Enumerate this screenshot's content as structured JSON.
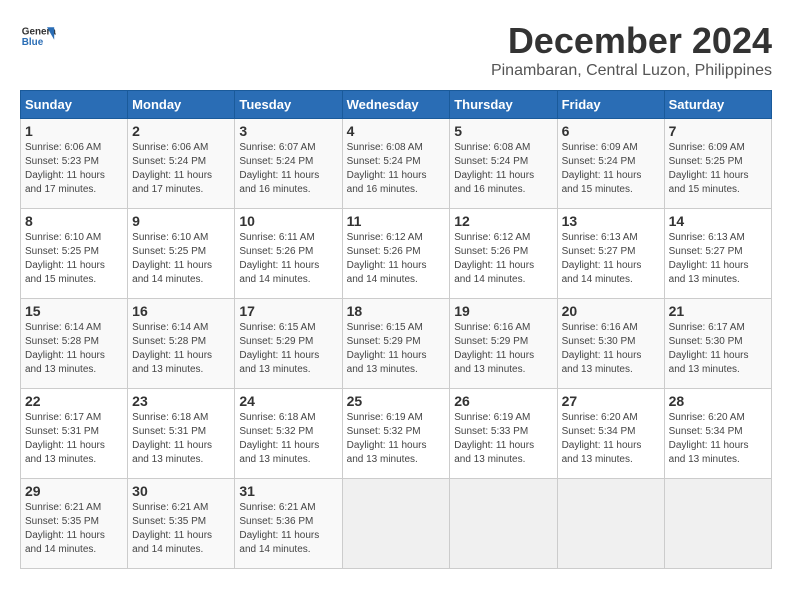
{
  "header": {
    "logo_line1": "General",
    "logo_line2": "Blue",
    "title": "December 2024",
    "subtitle": "Pinambaran, Central Luzon, Philippines"
  },
  "calendar": {
    "columns": [
      "Sunday",
      "Monday",
      "Tuesday",
      "Wednesday",
      "Thursday",
      "Friday",
      "Saturday"
    ],
    "weeks": [
      [
        null,
        {
          "day": 2,
          "sunrise": "6:06 AM",
          "sunset": "5:24 PM",
          "daylight": "11 hours and 17 minutes."
        },
        {
          "day": 3,
          "sunrise": "6:07 AM",
          "sunset": "5:24 PM",
          "daylight": "11 hours and 16 minutes."
        },
        {
          "day": 4,
          "sunrise": "6:08 AM",
          "sunset": "5:24 PM",
          "daylight": "11 hours and 16 minutes."
        },
        {
          "day": 5,
          "sunrise": "6:08 AM",
          "sunset": "5:24 PM",
          "daylight": "11 hours and 16 minutes."
        },
        {
          "day": 6,
          "sunrise": "6:09 AM",
          "sunset": "5:24 PM",
          "daylight": "11 hours and 15 minutes."
        },
        {
          "day": 7,
          "sunrise": "6:09 AM",
          "sunset": "5:25 PM",
          "daylight": "11 hours and 15 minutes."
        }
      ],
      [
        {
          "day": 1,
          "sunrise": "6:06 AM",
          "sunset": "5:23 PM",
          "daylight": "11 hours and 17 minutes."
        },
        {
          "day": 9,
          "sunrise": "6:10 AM",
          "sunset": "5:25 PM",
          "daylight": "11 hours and 14 minutes."
        },
        {
          "day": 10,
          "sunrise": "6:11 AM",
          "sunset": "5:26 PM",
          "daylight": "11 hours and 14 minutes."
        },
        {
          "day": 11,
          "sunrise": "6:12 AM",
          "sunset": "5:26 PM",
          "daylight": "11 hours and 14 minutes."
        },
        {
          "day": 12,
          "sunrise": "6:12 AM",
          "sunset": "5:26 PM",
          "daylight": "11 hours and 14 minutes."
        },
        {
          "day": 13,
          "sunrise": "6:13 AM",
          "sunset": "5:27 PM",
          "daylight": "11 hours and 14 minutes."
        },
        {
          "day": 14,
          "sunrise": "6:13 AM",
          "sunset": "5:27 PM",
          "daylight": "11 hours and 13 minutes."
        }
      ],
      [
        {
          "day": 8,
          "sunrise": "6:10 AM",
          "sunset": "5:25 PM",
          "daylight": "11 hours and 15 minutes."
        },
        {
          "day": 16,
          "sunrise": "6:14 AM",
          "sunset": "5:28 PM",
          "daylight": "11 hours and 13 minutes."
        },
        {
          "day": 17,
          "sunrise": "6:15 AM",
          "sunset": "5:29 PM",
          "daylight": "11 hours and 13 minutes."
        },
        {
          "day": 18,
          "sunrise": "6:15 AM",
          "sunset": "5:29 PM",
          "daylight": "11 hours and 13 minutes."
        },
        {
          "day": 19,
          "sunrise": "6:16 AM",
          "sunset": "5:29 PM",
          "daylight": "11 hours and 13 minutes."
        },
        {
          "day": 20,
          "sunrise": "6:16 AM",
          "sunset": "5:30 PM",
          "daylight": "11 hours and 13 minutes."
        },
        {
          "day": 21,
          "sunrise": "6:17 AM",
          "sunset": "5:30 PM",
          "daylight": "11 hours and 13 minutes."
        }
      ],
      [
        {
          "day": 15,
          "sunrise": "6:14 AM",
          "sunset": "5:28 PM",
          "daylight": "11 hours and 13 minutes."
        },
        {
          "day": 23,
          "sunrise": "6:18 AM",
          "sunset": "5:31 PM",
          "daylight": "11 hours and 13 minutes."
        },
        {
          "day": 24,
          "sunrise": "6:18 AM",
          "sunset": "5:32 PM",
          "daylight": "11 hours and 13 minutes."
        },
        {
          "day": 25,
          "sunrise": "6:19 AM",
          "sunset": "5:32 PM",
          "daylight": "11 hours and 13 minutes."
        },
        {
          "day": 26,
          "sunrise": "6:19 AM",
          "sunset": "5:33 PM",
          "daylight": "11 hours and 13 minutes."
        },
        {
          "day": 27,
          "sunrise": "6:20 AM",
          "sunset": "5:34 PM",
          "daylight": "11 hours and 13 minutes."
        },
        {
          "day": 28,
          "sunrise": "6:20 AM",
          "sunset": "5:34 PM",
          "daylight": "11 hours and 13 minutes."
        }
      ],
      [
        {
          "day": 22,
          "sunrise": "6:17 AM",
          "sunset": "5:31 PM",
          "daylight": "11 hours and 13 minutes."
        },
        {
          "day": 30,
          "sunrise": "6:21 AM",
          "sunset": "5:35 PM",
          "daylight": "11 hours and 14 minutes."
        },
        {
          "day": 31,
          "sunrise": "6:21 AM",
          "sunset": "5:36 PM",
          "daylight": "11 hours and 14 minutes."
        },
        null,
        null,
        null,
        null
      ],
      [
        {
          "day": 29,
          "sunrise": "6:21 AM",
          "sunset": "5:35 PM",
          "daylight": "11 hours and 14 minutes."
        },
        null,
        null,
        null,
        null,
        null,
        null
      ]
    ]
  }
}
